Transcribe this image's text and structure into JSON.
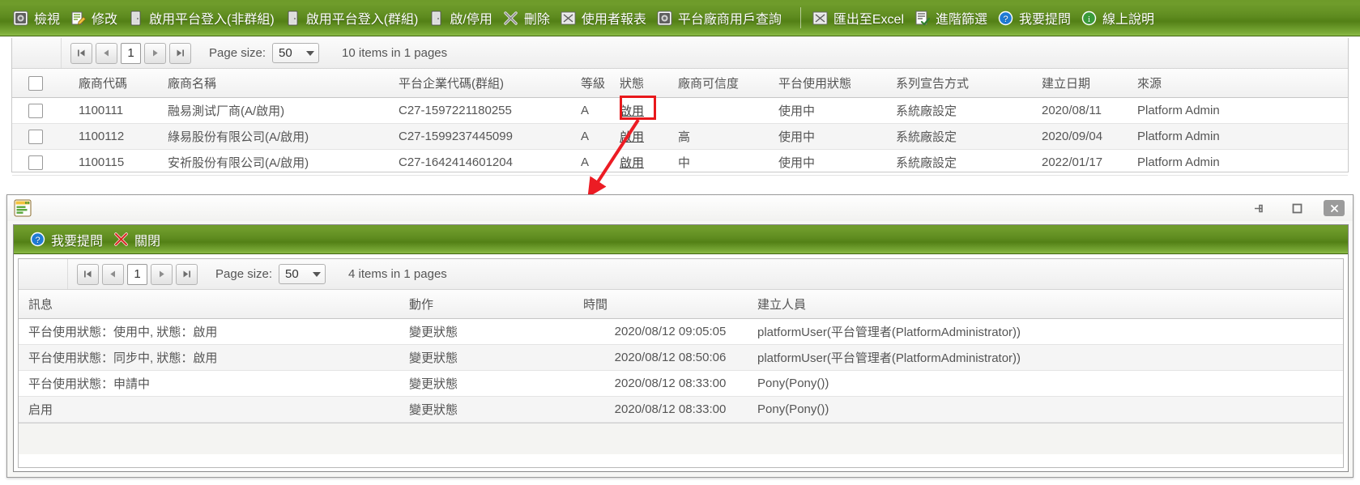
{
  "toolbar": {
    "items": [
      {
        "label": "檢視",
        "icon": "view-icon"
      },
      {
        "label": "修改",
        "icon": "edit-icon"
      },
      {
        "label": "啟用平台登入(非群組)",
        "icon": "door-icon"
      },
      {
        "label": "啟用平台登入(群組)",
        "icon": "door-icon"
      },
      {
        "label": "啟/停用",
        "icon": "door-icon"
      },
      {
        "label": "刪除",
        "icon": "delete-icon"
      },
      {
        "label": "使用者報表",
        "icon": "report-icon"
      },
      {
        "label": "平台廠商用戶查詢",
        "icon": "search-vendor-icon"
      }
    ],
    "items2": [
      {
        "label": "匯出至Excel",
        "icon": "excel-icon"
      },
      {
        "label": "進階篩選",
        "icon": "filter-icon"
      },
      {
        "label": "我要提問",
        "icon": "question-icon"
      },
      {
        "label": "線上說明",
        "icon": "info-icon"
      }
    ]
  },
  "main_pager": {
    "page_value": "1",
    "page_size_label": "Page size:",
    "page_size_value": "50",
    "count_text": "10 items in 1 pages"
  },
  "main_grid": {
    "headers": [
      "",
      "廠商代碼",
      "廠商名稱",
      "平台企業代碼(群組)",
      "等級",
      "狀態",
      "廠商可信度",
      "平台使用狀態",
      "系列宣告方式",
      "建立日期",
      "來源"
    ],
    "rows": [
      {
        "code": "1100111",
        "name": "融易測试厂商(A/啟用)",
        "enterprise": "C27-1597221180255",
        "level": "A",
        "status": "啟用",
        "trust": "",
        "usage": "使用中",
        "declare": "系統廠設定",
        "date": "2020/08/11",
        "source": "Platform Admin"
      },
      {
        "code": "1100112",
        "name": "綠易股份有限公司(A/啟用)",
        "enterprise": "C27-1599237445099",
        "level": "A",
        "status": "啟用",
        "trust": "高",
        "usage": "使用中",
        "declare": "系統廠設定",
        "date": "2020/09/04",
        "source": "Platform Admin"
      },
      {
        "code": "1100115",
        "name": "安祈股份有限公司(A/啟用)",
        "enterprise": "C27-1642414601204",
        "level": "A",
        "status": "啟用",
        "trust": "中",
        "usage": "使用中",
        "declare": "系統廠設定",
        "date": "2022/01/17",
        "source": "Platform Admin"
      }
    ]
  },
  "dialog": {
    "title_icon": "document-icon",
    "window_buttons": [
      {
        "name": "pin-icon"
      },
      {
        "name": "maximize-icon"
      },
      {
        "name": "close-icon"
      }
    ],
    "toolbar": [
      {
        "label": "我要提問",
        "icon": "question-icon"
      },
      {
        "label": "關閉",
        "icon": "close-x-icon"
      }
    ],
    "pager": {
      "page_value": "1",
      "page_size_label": "Page size:",
      "page_size_value": "50",
      "count_text": "4 items in 1 pages"
    },
    "grid": {
      "headers": [
        "訊息",
        "動作",
        "時間",
        "建立人員"
      ],
      "rows": [
        {
          "message": "平台使用狀態：使用中, 狀態：啟用",
          "action": "變更狀態",
          "time": "2020/08/12 09:05:05",
          "creator": "platformUser(平台管理者(PlatformAdministrator))"
        },
        {
          "message": "平台使用狀態：同步中, 狀態：啟用",
          "action": "變更狀態",
          "time": "2020/08/12 08:50:06",
          "creator": "platformUser(平台管理者(PlatformAdministrator))"
        },
        {
          "message": "平台使用狀態：申請中",
          "action": "變更狀態",
          "time": "2020/08/12 08:33:00",
          "creator": "Pony(Pony())"
        },
        {
          "message": "启用",
          "action": "變更狀態",
          "time": "2020/08/12 08:33:00",
          "creator": "Pony(Pony())"
        }
      ]
    }
  },
  "annotation": {
    "highlight_color": "#e8181b",
    "arrow_color": "#ec1c24"
  }
}
